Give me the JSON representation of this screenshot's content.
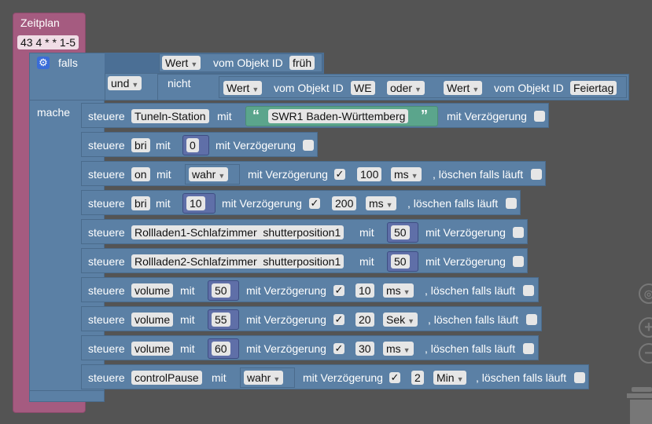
{
  "schedule": {
    "title": "Zeitplan",
    "cron": "43 4 * * 1-5"
  },
  "if_block": {
    "label": "falls",
    "do_label": "mache",
    "cond1": {
      "prop": "Wert",
      "of_object": "vom Objekt ID",
      "id": "früh"
    },
    "logic_op": "und",
    "not_label": "nicht",
    "cond2": {
      "prop": "Wert",
      "of_object": "vom Objekt ID",
      "id": "WE"
    },
    "or_op": "oder",
    "cond3": {
      "prop": "Wert",
      "of_object": "vom Objekt ID",
      "id": "Feiertag"
    }
  },
  "common": {
    "control": "steuere",
    "with": "mit",
    "with_delay": "mit Verzögerung",
    "clear_running": ", löschen falls läuft",
    "check": "✓"
  },
  "rows": [
    {
      "target": "Tuneln-Station",
      "value": "SWR1 Baden-Württemberg",
      "value_kind": "text"
    },
    {
      "target": "bri",
      "value": "0",
      "value_kind": "number"
    },
    {
      "target": "on",
      "value": "wahr",
      "value_kind": "bool",
      "delay": "100",
      "unit": "ms"
    },
    {
      "target": "bri",
      "value": "10",
      "value_kind": "number",
      "delay": "200",
      "unit": "ms"
    },
    {
      "target": "Rollladen1-Schlafzimmer  shutterposition1",
      "value": "50",
      "value_kind": "number"
    },
    {
      "target": "Rollladen2-Schlafzimmer  shutterposition1",
      "value": "50",
      "value_kind": "number"
    },
    {
      "target": "volume",
      "value": "50",
      "value_kind": "number",
      "delay": "10",
      "unit": "ms"
    },
    {
      "target": "volume",
      "value": "55",
      "value_kind": "number",
      "delay": "20",
      "unit": "Sek"
    },
    {
      "target": "volume",
      "value": "60",
      "value_kind": "number",
      "delay": "30",
      "unit": "ms"
    },
    {
      "target": "controlPause",
      "value": "wahr",
      "value_kind": "bool",
      "delay": "2",
      "unit": "Min"
    }
  ],
  "controls": {
    "zoom_in": "+",
    "zoom_out": "−"
  },
  "colors": {
    "workspace": "#545454",
    "schedule_block": "#a55b80",
    "control_block": "#5b80a5",
    "number_block": "#5f6fa8",
    "text_block": "#5ba58c"
  }
}
